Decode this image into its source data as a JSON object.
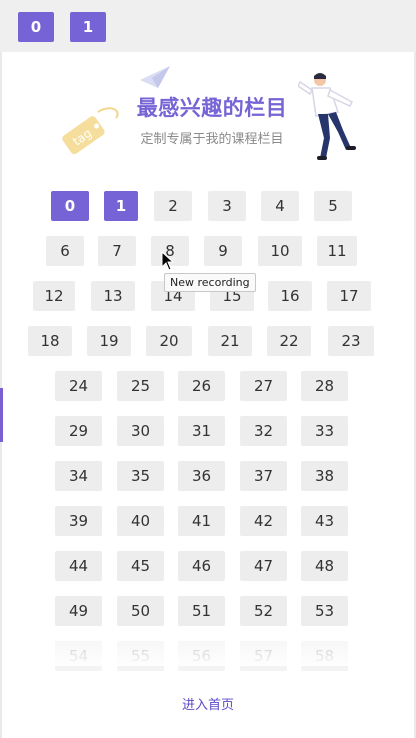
{
  "top_tabs": [
    "0",
    "1"
  ],
  "header": {
    "title": "最感兴趣的栏目",
    "subtitle": "定制专属于我的课程栏目",
    "tag_text": "tag"
  },
  "grid": {
    "items": [
      "0",
      "1",
      "2",
      "3",
      "4",
      "5",
      "6",
      "7",
      "8",
      "9",
      "10",
      "11",
      "12",
      "13",
      "14",
      "15",
      "16",
      "17",
      "18",
      "19",
      "20",
      "21",
      "22",
      "23",
      "24",
      "25",
      "26",
      "27",
      "28",
      "29",
      "30",
      "31",
      "32",
      "33",
      "34",
      "35",
      "36",
      "37",
      "38",
      "39",
      "40",
      "41",
      "42",
      "43",
      "44",
      "45",
      "46",
      "47",
      "48",
      "49",
      "50",
      "51",
      "52",
      "53",
      "54",
      "55",
      "56",
      "57",
      "58"
    ],
    "selected": [
      "0",
      "1"
    ]
  },
  "tooltip": "New recording",
  "footer": {
    "enter_label": "进入首页"
  },
  "colors": {
    "accent": "#7664d6",
    "chip_bg": "#ededed",
    "link": "#5b4ac9"
  }
}
